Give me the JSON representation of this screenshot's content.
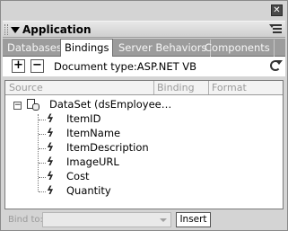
{
  "window": {
    "close_glyph": "✕"
  },
  "panel": {
    "title": "Application"
  },
  "tabs": [
    {
      "label": "Databases",
      "active": false
    },
    {
      "label": "Bindings",
      "active": true
    },
    {
      "label": "Server Behaviors",
      "active": false
    },
    {
      "label": "Components",
      "active": false
    }
  ],
  "toolbar": {
    "add_glyph": "+",
    "remove_glyph": "−",
    "document_type": "Document type:ASP.NET VB"
  },
  "grid": {
    "columns": [
      "Source",
      "Binding",
      "Format"
    ],
    "dataset": {
      "expand_glyph": "−",
      "label": "DataSet (dsEmployee…",
      "fields": [
        "ItemID",
        "ItemName",
        "ItemDescription",
        "ImageURL",
        "Cost",
        "Quantity"
      ]
    }
  },
  "bottom": {
    "bind_to_label": "Bind to:",
    "bind_to_value": "",
    "insert_label": "Insert"
  },
  "colors": {
    "tab_bar": "#9c9c9c",
    "panel_bg": "#d4d4d4",
    "disabled_text": "#9a9a9a"
  }
}
